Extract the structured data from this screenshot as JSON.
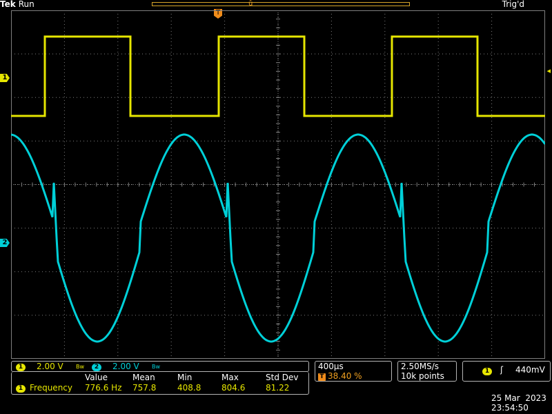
{
  "header": {
    "brand": "Tek",
    "state": "Run",
    "trigger_status": "Trig'd"
  },
  "markers": {
    "ch1": "1",
    "ch2": "2",
    "trigger": "T"
  },
  "channels": [
    {
      "id": "1",
      "scale": "2.00 V",
      "bw_label": "Bw",
      "color": "#e6e600"
    },
    {
      "id": "2",
      "scale": "2.00 V",
      "bw_label": "Bw",
      "color": "#00d0d8"
    }
  ],
  "measurement": {
    "headers": [
      "Value",
      "Mean",
      "Min",
      "Max",
      "Std Dev"
    ],
    "channel": "1",
    "name": "Frequency",
    "values": [
      "776.6 Hz",
      "757.8",
      "408.8",
      "804.6",
      "81.22"
    ]
  },
  "timebase": {
    "scale": "400µs",
    "trigger_icon": "T",
    "trigger_pos": "38.40 %"
  },
  "acquisition": {
    "sample_rate": "2.50MS/s",
    "record_length": "10k points"
  },
  "trigger": {
    "channel": "1",
    "slope_icon": "rising-edge-icon",
    "slope_glyph": "ʃ",
    "level": "440mV"
  },
  "datetime": {
    "date": "25 Mar  2023",
    "time": "23:54:50"
  },
  "colors": {
    "ch1": "#e6e600",
    "ch2": "#00d0d8",
    "trigger": "#f08c1a",
    "grid": "#808080"
  }
}
